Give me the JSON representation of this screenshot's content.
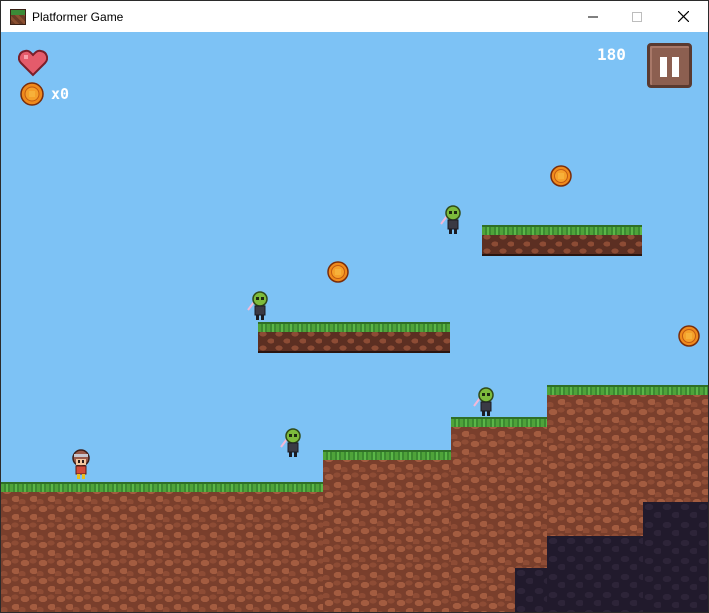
{
  "window": {
    "title": "Platformer Game",
    "buttons": [
      "minimize-icon",
      "maximize-icon",
      "close-icon"
    ]
  },
  "hud": {
    "lives": 1,
    "coin_count": "x0",
    "score": "180",
    "pause_icon": "pause-icon"
  },
  "colors": {
    "sky": "#7dc2f5",
    "grass": "#4fa33a",
    "dirt": "#7a3f2c",
    "cave": "#211a2c",
    "coin": "#f08a1c",
    "heart": "#e45b6b",
    "pause_button": "#8c5f50"
  },
  "scene": {
    "coins": 3,
    "enemies": 4,
    "players": 1,
    "floating_platforms": 2
  }
}
